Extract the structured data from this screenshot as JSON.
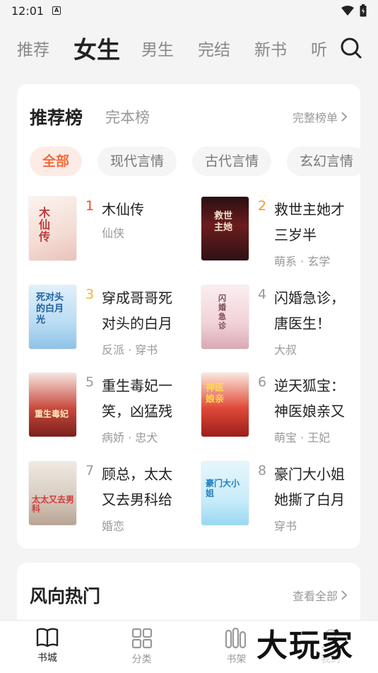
{
  "status_bar": {
    "time": "12:01",
    "notification_letter": "A"
  },
  "top_nav": {
    "tabs": [
      {
        "label": "推荐",
        "active": false
      },
      {
        "label": "女生",
        "active": true
      },
      {
        "label": "男生",
        "active": false
      },
      {
        "label": "完结",
        "active": false
      },
      {
        "label": "新书",
        "active": false
      },
      {
        "label": "听",
        "active": false
      }
    ],
    "search_icon": "search-icon"
  },
  "rank_card": {
    "tab_active": "推荐榜",
    "tab_other": "完本榜",
    "full_list_label": "完整榜单",
    "chips": [
      "全部",
      "现代言情",
      "古代言情",
      "玄幻言情"
    ],
    "books": [
      {
        "rank": "1",
        "title": "木仙传",
        "tags": "仙侠",
        "cover_text": "木仙传"
      },
      {
        "rank": "2",
        "title": "救世主她才三岁半",
        "tags": "萌系 · 玄学",
        "cover_text": "救世主她"
      },
      {
        "rank": "3",
        "title": "穿成哥哥死对头的白月",
        "tags": "反派 · 穿书",
        "cover_text": "死对头的白月光"
      },
      {
        "rank": "4",
        "title": "闪婚急诊，唐医生！",
        "tags": "大叔",
        "cover_text": "闪婚急诊"
      },
      {
        "rank": "5",
        "title": "重生毒妃一笑，凶猛残",
        "tags": "病娇 · 忠犬",
        "cover_text": "重生毒妃"
      },
      {
        "rank": "6",
        "title": "逆天狐宝：神医娘亲又",
        "tags": "萌宝 · 王妃",
        "cover_text": "神医娘亲"
      },
      {
        "rank": "7",
        "title": "顾总，太太又去男科给",
        "tags": "婚恋",
        "cover_text": "太太又去男科"
      },
      {
        "rank": "8",
        "title": "豪门大小姐她撕了白月",
        "tags": "穿书",
        "cover_text": "豪门大小姐"
      }
    ]
  },
  "hot_card": {
    "title": "风向热门",
    "more_label": "查看全部"
  },
  "bottom_nav": [
    {
      "label": "书城",
      "icon": "book-icon",
      "active": true
    },
    {
      "label": "分类",
      "icon": "grid-icon",
      "active": false
    },
    {
      "label": "书架",
      "icon": "bookshelf-icon",
      "active": false
    },
    {
      "label": "我的",
      "icon": "person-icon",
      "active": false
    }
  ],
  "watermark": "大玩家",
  "colors": {
    "accent": "#f26b3a",
    "rank1": "#f04a2a",
    "rank2": "#f5962a",
    "rank3": "#f5b52a"
  }
}
